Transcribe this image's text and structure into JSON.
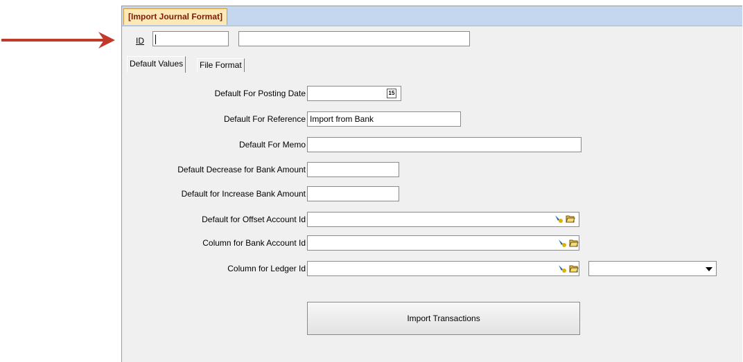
{
  "window": {
    "title": "[Import Journal Format]"
  },
  "header": {
    "id_label": "ID",
    "id_value": "",
    "description_value": ""
  },
  "tabs": [
    {
      "label": "Default Values",
      "active": true
    },
    {
      "label": "File Format",
      "active": false
    }
  ],
  "form": {
    "posting_date": {
      "label": "Default For Posting Date",
      "value": ""
    },
    "reference": {
      "label": "Default For Reference",
      "value": "Import from Bank"
    },
    "memo": {
      "label": "Default For Memo",
      "value": ""
    },
    "decrease": {
      "label": "Default Decrease for Bank Amount",
      "value": ""
    },
    "increase": {
      "label": "Default for Increase Bank Amount",
      "value": ""
    },
    "offset_account": {
      "label": "Default for Offset Account Id",
      "value": ""
    },
    "bank_account": {
      "label": "Column for Bank Account Id",
      "value": ""
    },
    "ledger": {
      "label": "Column for Ledger Id",
      "value": "",
      "dropdown_value": ""
    }
  },
  "actions": {
    "import_label": "Import Transactions"
  },
  "icons": {
    "calendar": "calendar-icon",
    "lookup": "lookup-arrow-icon",
    "folder": "folder-open-icon",
    "dropdown": "chevron-down-icon"
  },
  "colors": {
    "arrow": "#c0392b",
    "title_tab_bg": "#fde8b8",
    "title_tab_text": "#7a1e00",
    "titlebar": "#c5d7ee"
  },
  "calendar_glyph": "15"
}
